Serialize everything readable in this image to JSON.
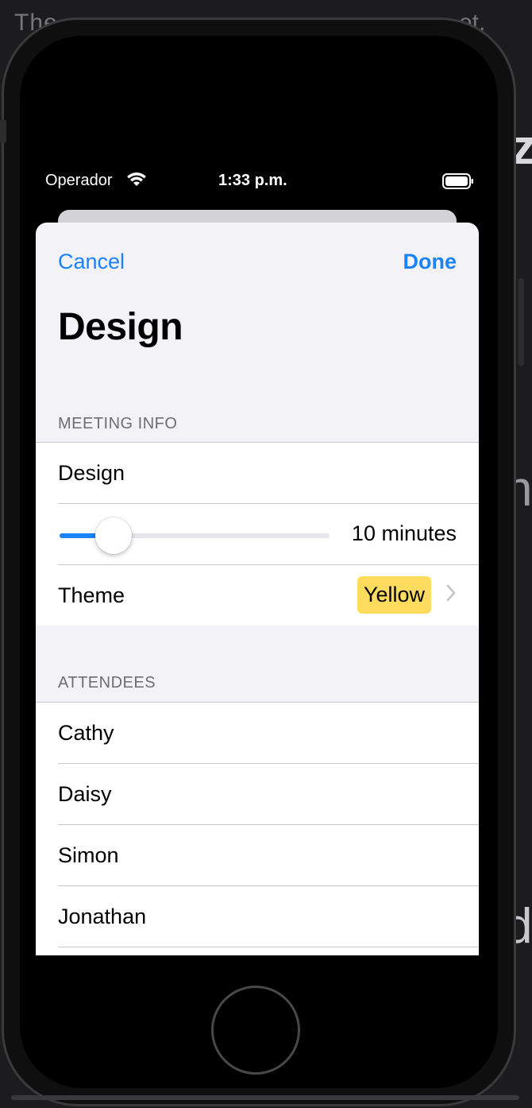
{
  "background": {
    "top_text": "The",
    "top_text_right": "et.",
    "side_letter_z": "z",
    "side_letter_n": "n",
    "side_letter_d": "d"
  },
  "statusbar": {
    "carrier": "Operador",
    "time": "1:33 p.m.",
    "wifi_icon": "wifi-icon",
    "battery_icon": "battery-icon"
  },
  "nav": {
    "cancel_label": "Cancel",
    "done_label": "Done"
  },
  "title": "Design",
  "meeting_info": {
    "header": "MEETING INFO",
    "title_value": "Design",
    "length": {
      "value_fraction": 0.2,
      "label": "10 minutes"
    },
    "theme": {
      "label": "Theme",
      "value": "Yellow",
      "color": "#ffdc5e"
    }
  },
  "attendees": {
    "header": "ATTENDEES",
    "items": [
      "Cathy",
      "Daisy",
      "Simon",
      "Jonathan"
    ]
  },
  "colors": {
    "accent": "#1a82fb",
    "sheet_background": "#f2f2f7"
  }
}
